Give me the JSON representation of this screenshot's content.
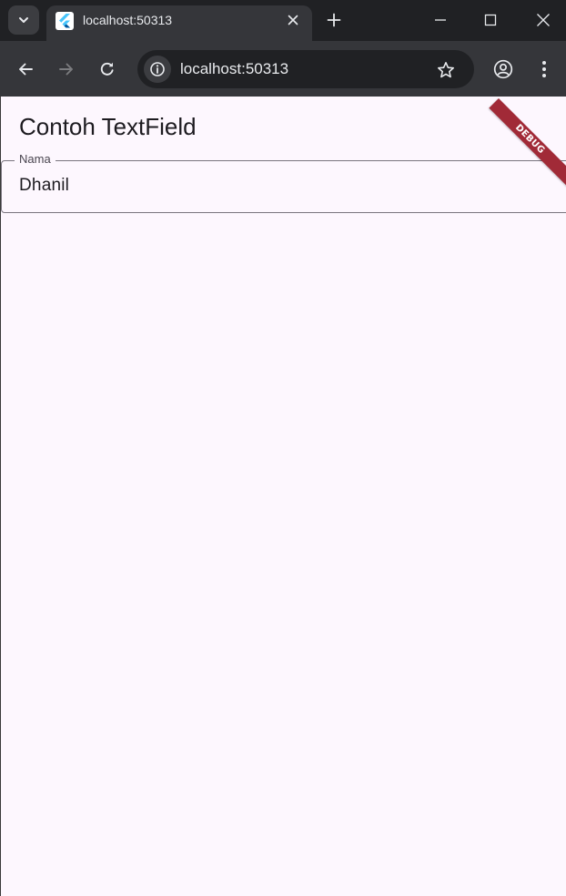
{
  "browser": {
    "tab": {
      "title": "localhost:50313",
      "favicon": "flutter-logo-icon"
    },
    "omnibox": {
      "url": "localhost:50313"
    },
    "icons": {
      "tab_search": "chevron-down-icon",
      "tab_close": "close-icon",
      "new_tab": "plus-icon",
      "minimize": "minimize-icon",
      "maximize": "maximize-icon",
      "close": "close-icon",
      "back": "arrow-left-icon",
      "forward": "arrow-right-icon",
      "reload": "reload-icon",
      "site_info": "info-icon",
      "bookmark": "star-icon",
      "profile": "account-icon",
      "menu": "more-vertical-icon"
    }
  },
  "app": {
    "title": "Contoh TextField",
    "debug_banner": "DEBUG",
    "textfield": {
      "label": "Nama",
      "value": "Dhanil"
    }
  },
  "colors": {
    "page_background": "#fdf7fe",
    "debug_banner": "#a12a37",
    "field_border": "#79747e",
    "browser_frame": "#202124",
    "browser_toolbar": "#35363a"
  }
}
